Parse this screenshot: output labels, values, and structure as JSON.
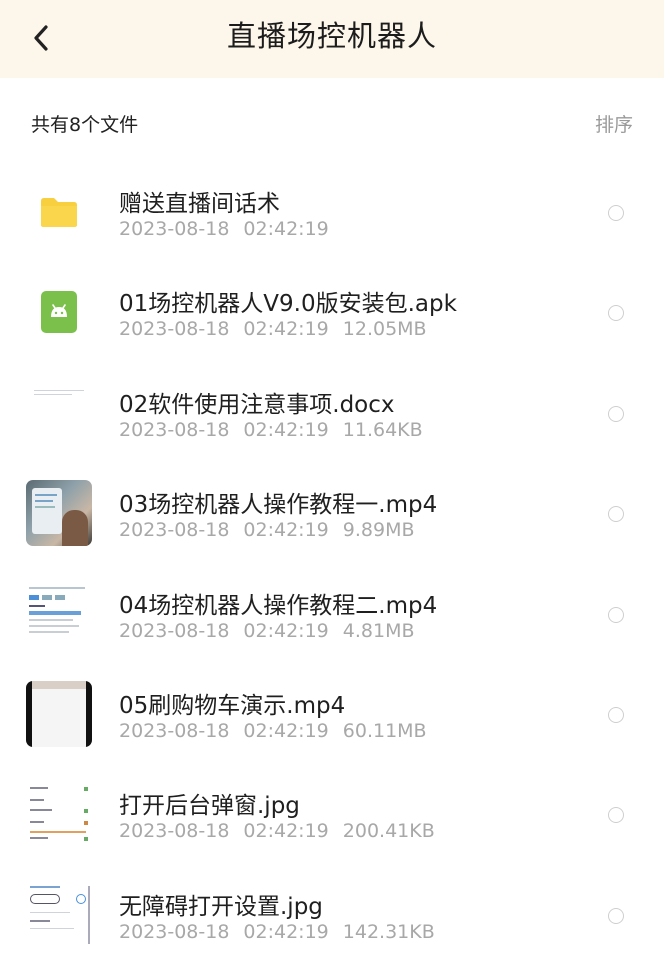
{
  "header": {
    "title": "直播场控机器人"
  },
  "summary": {
    "count_label": "共有8个文件",
    "sort_label": "排序"
  },
  "files": [
    {
      "name": "赠送直播间话术",
      "date": "2023-08-18",
      "time": "02:42:19",
      "size": "",
      "icon": "folder-icon"
    },
    {
      "name": "01场控机器人V9.0版安装包.apk",
      "date": "2023-08-18",
      "time": "02:42:19",
      "size": "12.05MB",
      "icon": "android-apk-icon"
    },
    {
      "name": "02软件使用注意事项.docx",
      "date": "2023-08-18",
      "time": "02:42:19",
      "size": "11.64KB",
      "icon": "document-thumbnail"
    },
    {
      "name": "03场控机器人操作教程一.mp4",
      "date": "2023-08-18",
      "time": "02:42:19",
      "size": "9.89MB",
      "icon": "video-thumbnail"
    },
    {
      "name": "04场控机器人操作教程二.mp4",
      "date": "2023-08-18",
      "time": "02:42:19",
      "size": "4.81MB",
      "icon": "video-thumbnail"
    },
    {
      "name": "05刷购物车演示.mp4",
      "date": "2023-08-18",
      "time": "02:42:19",
      "size": "60.11MB",
      "icon": "video-thumbnail"
    },
    {
      "name": "打开后台弹窗.jpg",
      "date": "2023-08-18",
      "time": "02:42:19",
      "size": "200.41KB",
      "icon": "image-thumbnail"
    },
    {
      "name": "无障碍打开设置.jpg",
      "date": "2023-08-18",
      "time": "02:42:19",
      "size": "142.31KB",
      "icon": "image-thumbnail"
    }
  ],
  "colors": {
    "header_bg": "#fdf6ea",
    "folder": "#f7cf3f",
    "apk": "#7bc04a",
    "meta_text": "#a8a8a8"
  }
}
